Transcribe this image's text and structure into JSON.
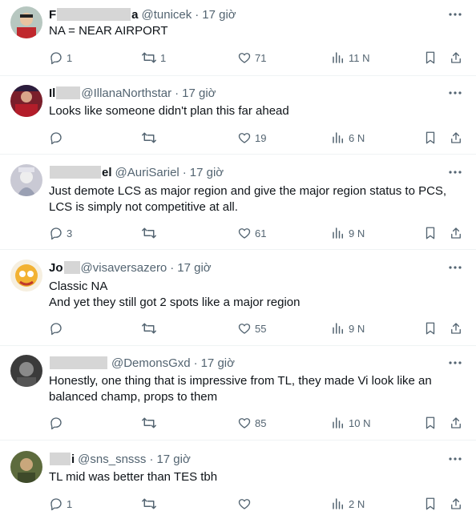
{
  "tweets": [
    {
      "name_start": "F",
      "name_end": "a",
      "handle": "@tunicek",
      "time": "17 giờ",
      "lines": [
        "NA = NEAR AIRPORT"
      ],
      "replies": "1",
      "reposts": "1",
      "likes": "71",
      "views": "11 N",
      "avatar_color": "#b7c7c0"
    },
    {
      "name_start": "Il",
      "name_end": "",
      "handle": "@IllanaNorthstar",
      "time": "17 giờ",
      "lines": [
        "Looks like someone didn't plan this far ahead"
      ],
      "replies": "",
      "reposts": "",
      "likes": "19",
      "views": "6 N",
      "avatar_color": "#7a1f2b"
    },
    {
      "name_start": "",
      "name_end": "el",
      "handle": "@AuriSariel",
      "time": "17 giờ",
      "lines": [
        "Just demote LCS as major region and give the major region status to PCS,",
        "LCS is simply not competitive at all."
      ],
      "replies": "3",
      "reposts": "",
      "likes": "61",
      "views": "9 N",
      "avatar_color": "#c9c9d4"
    },
    {
      "name_start": "Jo",
      "name_end": "",
      "handle": "@visaversazero",
      "time": "17 giờ",
      "lines": [
        "Classic NA",
        "And yet they still got 2 spots like a major region"
      ],
      "replies": "",
      "reposts": "",
      "likes": "55",
      "views": "9 N",
      "avatar_color": "#f2b233"
    },
    {
      "name_start": "",
      "name_end": "",
      "handle": "@DemonsGxd",
      "time": "17 giờ",
      "lines": [
        "Honestly, one thing that is impressive from TL, they made Vi look like an",
        "balanced champ, props to them"
      ],
      "replies": "",
      "reposts": "",
      "likes": "85",
      "views": "10 N",
      "avatar_color": "#3b3b3b"
    },
    {
      "name_start": "",
      "name_end": "i",
      "handle": "@sns_snsss",
      "time": "17 giờ",
      "lines": [
        "TL mid was better than TES tbh"
      ],
      "replies": "1",
      "reposts": "",
      "likes": "",
      "views": "2 N",
      "avatar_color": "#5d6b3d"
    }
  ]
}
